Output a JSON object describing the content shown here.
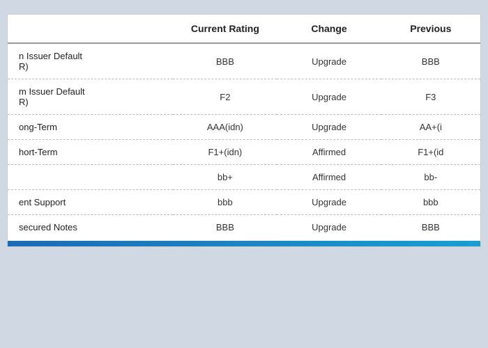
{
  "table": {
    "columns": {
      "label": "",
      "current_rating": "Current Rating",
      "change": "Change",
      "previous": "Previous"
    },
    "rows": [
      {
        "label": "n Issuer Default\nR)",
        "current_rating": "BBB",
        "change": "Upgrade",
        "previous": "BBB"
      },
      {
        "label": "m Issuer Default\nR)",
        "current_rating": "F2",
        "change": "Upgrade",
        "previous": "F3"
      },
      {
        "label": "ong-Term",
        "current_rating": "AAA(idn)",
        "change": "Upgrade",
        "previous": "AA+(i"
      },
      {
        "label": "hort-Term",
        "current_rating": "F1+(idn)",
        "change": "Affirmed",
        "previous": "F1+(id"
      },
      {
        "label": "",
        "current_rating": "bb+",
        "change": "Affirmed",
        "previous": "bb-"
      },
      {
        "label": "ent Support",
        "current_rating": "bbb",
        "change": "Upgrade",
        "previous": "bbb"
      },
      {
        "label": "secured Notes",
        "current_rating": "BBB",
        "change": "Upgrade",
        "previous": "BBB"
      }
    ]
  }
}
